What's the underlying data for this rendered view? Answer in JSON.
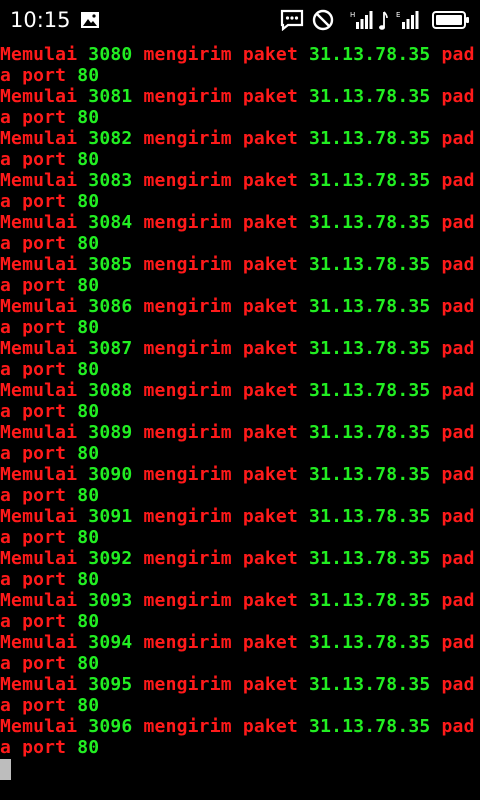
{
  "status_bar": {
    "time": "10:15",
    "icons": [
      "image-icon",
      "chat-icon",
      "do-not-disturb-icon",
      "signal-h-icon",
      "music-note-icon",
      "signal-e-icon",
      "battery-icon"
    ]
  },
  "terminal": {
    "colors": {
      "text_red": "#ff1a1a",
      "text_green": "#22ee22",
      "background": "#000000",
      "cursor": "#bdbdbd"
    },
    "lines": [
      {
        "prefix": "Memulai ",
        "number": "3080",
        "middle": " mengirim paket ",
        "ip": "31.13.78.35",
        "suffix1": " pad",
        "suffix2": "a port ",
        "port": "80"
      },
      {
        "prefix": "Memulai ",
        "number": "3081",
        "middle": " mengirim paket ",
        "ip": "31.13.78.35",
        "suffix1": " pad",
        "suffix2": "a port ",
        "port": "80"
      },
      {
        "prefix": "Memulai ",
        "number": "3082",
        "middle": " mengirim paket ",
        "ip": "31.13.78.35",
        "suffix1": " pad",
        "suffix2": "a port ",
        "port": "80"
      },
      {
        "prefix": "Memulai ",
        "number": "3083",
        "middle": " mengirim paket ",
        "ip": "31.13.78.35",
        "suffix1": " pad",
        "suffix2": "a port ",
        "port": "80"
      },
      {
        "prefix": "Memulai ",
        "number": "3084",
        "middle": " mengirim paket ",
        "ip": "31.13.78.35",
        "suffix1": " pad",
        "suffix2": "a port ",
        "port": "80"
      },
      {
        "prefix": "Memulai ",
        "number": "3085",
        "middle": " mengirim paket ",
        "ip": "31.13.78.35",
        "suffix1": " pad",
        "suffix2": "a port ",
        "port": "80"
      },
      {
        "prefix": "Memulai ",
        "number": "3086",
        "middle": " mengirim paket ",
        "ip": "31.13.78.35",
        "suffix1": " pad",
        "suffix2": "a port ",
        "port": "80"
      },
      {
        "prefix": "Memulai ",
        "number": "3087",
        "middle": " mengirim paket ",
        "ip": "31.13.78.35",
        "suffix1": " pad",
        "suffix2": "a port ",
        "port": "80"
      },
      {
        "prefix": "Memulai ",
        "number": "3088",
        "middle": " mengirim paket ",
        "ip": "31.13.78.35",
        "suffix1": " pad",
        "suffix2": "a port ",
        "port": "80"
      },
      {
        "prefix": "Memulai ",
        "number": "3089",
        "middle": " mengirim paket ",
        "ip": "31.13.78.35",
        "suffix1": " pad",
        "suffix2": "a port ",
        "port": "80"
      },
      {
        "prefix": "Memulai ",
        "number": "3090",
        "middle": " mengirim paket ",
        "ip": "31.13.78.35",
        "suffix1": " pad",
        "suffix2": "a port ",
        "port": "80"
      },
      {
        "prefix": "Memulai ",
        "number": "3091",
        "middle": " mengirim paket ",
        "ip": "31.13.78.35",
        "suffix1": " pad",
        "suffix2": "a port ",
        "port": "80"
      },
      {
        "prefix": "Memulai ",
        "number": "3092",
        "middle": " mengirim paket ",
        "ip": "31.13.78.35",
        "suffix1": " pad",
        "suffix2": "a port ",
        "port": "80"
      },
      {
        "prefix": "Memulai ",
        "number": "3093",
        "middle": " mengirim paket ",
        "ip": "31.13.78.35",
        "suffix1": " pad",
        "suffix2": "a port ",
        "port": "80"
      },
      {
        "prefix": "Memulai ",
        "number": "3094",
        "middle": " mengirim paket ",
        "ip": "31.13.78.35",
        "suffix1": " pad",
        "suffix2": "a port ",
        "port": "80"
      },
      {
        "prefix": "Memulai ",
        "number": "3095",
        "middle": " mengirim paket ",
        "ip": "31.13.78.35",
        "suffix1": " pad",
        "suffix2": "a port ",
        "port": "80"
      },
      {
        "prefix": "Memulai ",
        "number": "3096",
        "middle": " mengirim paket ",
        "ip": "31.13.78.35",
        "suffix1": " pad",
        "suffix2": "a port ",
        "port": "80"
      }
    ]
  }
}
